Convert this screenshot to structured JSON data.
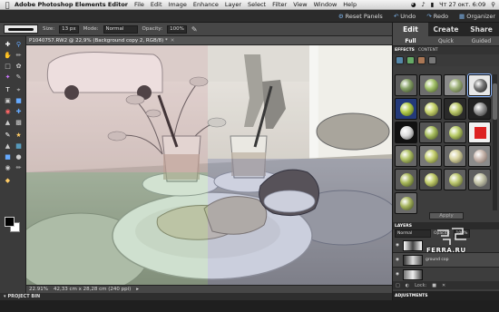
{
  "menubar": {
    "app_name": "Adobe Photoshop Elements Editor",
    "items": [
      "File",
      "Edit",
      "Image",
      "Enhance",
      "Layer",
      "Select",
      "Filter",
      "View",
      "Window",
      "Help"
    ],
    "clock": "Чт 27 окт.  6:09"
  },
  "appbar": {
    "reset_panels": "Reset Panels",
    "undo": "Undo",
    "redo": "Redo",
    "organizer": "Organizer"
  },
  "options": {
    "size_label": "Size:",
    "size_value": "13 px",
    "mode_label": "Mode:",
    "mode_value": "Normal",
    "opacity_label": "Opacity:",
    "opacity_value": "100%"
  },
  "document": {
    "tab_title": "P1040757.RW2 @ 22,9% (Background copy 2, RGB/8) *",
    "zoom": "22.91%",
    "dimensions": "42,33 cm x 28,28 cm (240 ppi)"
  },
  "project_bin_label": "PROJECT BIN",
  "panel": {
    "main_tabs": [
      "Edit",
      "Create",
      "Share"
    ],
    "sub_tabs": [
      "Full",
      "Quick",
      "Guided"
    ],
    "panel_tabs": [
      "EFFECTS",
      "CONTENT"
    ],
    "apply_label": "Apply",
    "layers_header": "LAYERS",
    "blend_mode": "Normal",
    "opacity_label": "Opacity:",
    "opacity_value": "100%",
    "layers": [
      "",
      "ground cop",
      ""
    ],
    "lock_label": "Lock:",
    "adjustments_header": "ADJUSTMENTS"
  },
  "watermark": "FERRA.RU",
  "colors": {
    "accent": "#7bb0e6",
    "selection": "#8ab6ff"
  }
}
